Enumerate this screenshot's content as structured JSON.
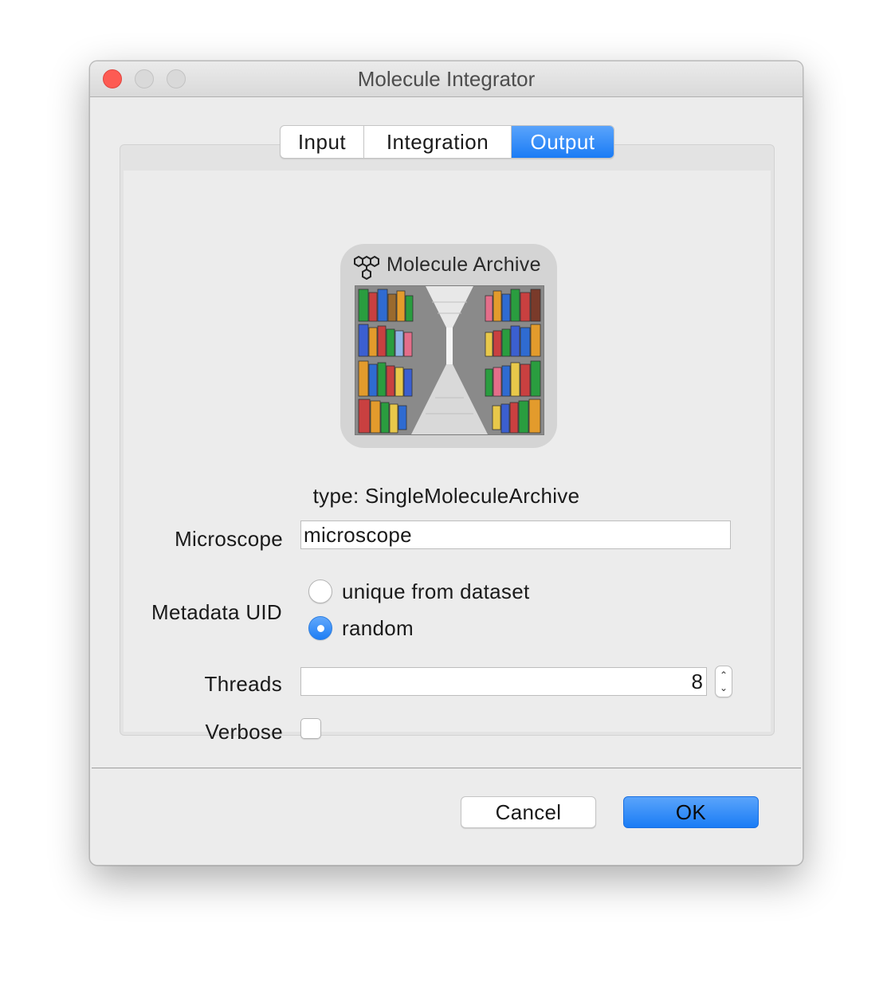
{
  "window": {
    "title": "Molecule Integrator"
  },
  "tabs": [
    {
      "label": "Input",
      "active": false
    },
    {
      "label": "Integration",
      "active": false
    },
    {
      "label": "Output",
      "active": true
    }
  ],
  "logo": {
    "title": "Molecule Archive",
    "icon": "molecule-icon"
  },
  "type_label": "type: SingleMoleculeArchive",
  "form": {
    "microscope": {
      "label": "Microscope",
      "value": "microscope"
    },
    "metadata_uid": {
      "label": "Metadata UID",
      "options": [
        {
          "label": "unique from dataset",
          "checked": false
        },
        {
          "label": "random",
          "checked": true
        }
      ]
    },
    "threads": {
      "label": "Threads",
      "value": "8"
    },
    "verbose": {
      "label": "Verbose",
      "checked": false
    }
  },
  "buttons": {
    "cancel": "Cancel",
    "ok": "OK"
  },
  "colors": {
    "accent": "#1a7cf5",
    "close": "#fd5b53"
  }
}
